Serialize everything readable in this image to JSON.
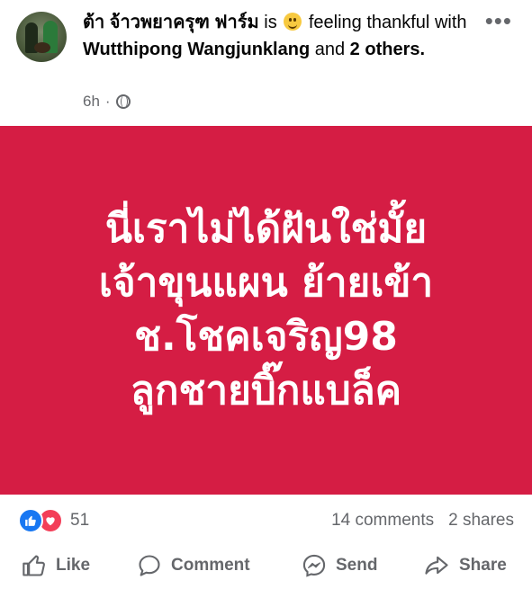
{
  "post": {
    "author": "ต้า จ้าวพยาครุฑ ฟาร์ม",
    "is_word": "is",
    "feeling": "feeling thankful",
    "with_word": "with",
    "tagged": "Wutthipong Wangjunklang",
    "and_word": "and",
    "others": "2 others.",
    "time": "6h",
    "dot": "·",
    "more": "•••",
    "icons": {
      "emoji": "smiling-face-icon",
      "privacy": "globe-icon",
      "more": "more-options-icon"
    }
  },
  "banner": {
    "background": "#d51d44",
    "lines": [
      "นี่เราไม่ได้ฝันใช่มั้ย",
      "เจ้าขุนแผน ย้ายเข้า",
      "ช.โชคเจริญ98",
      "ลูกชายบิ๊กแบล็ค"
    ]
  },
  "stats": {
    "reaction_count": "51",
    "comments": "14 comments",
    "shares": "2 shares",
    "colors": {
      "like": "#1877f2",
      "love": "#f33e58"
    }
  },
  "actions": {
    "like": "Like",
    "comment": "Comment",
    "send": "Send",
    "share": "Share"
  }
}
